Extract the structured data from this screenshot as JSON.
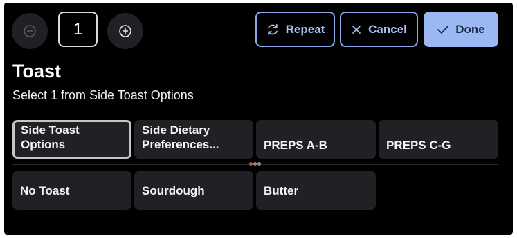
{
  "quantity": {
    "value": "1"
  },
  "actions": {
    "repeat_label": "Repeat",
    "cancel_label": "Cancel",
    "done_label": "Done"
  },
  "header": {
    "title": "Toast",
    "subtitle": "Select 1 from Side Toast Options"
  },
  "groups": [
    {
      "label": "Side Toast Options",
      "selected": true
    },
    {
      "label": "Side Dietary Preferences...",
      "selected": false
    },
    {
      "label": "PREPS A-B",
      "selected": false
    },
    {
      "label": "PREPS C-G",
      "selected": false
    }
  ],
  "pager": {
    "dots": 3,
    "active_index": 0
  },
  "options": [
    {
      "label": "No Toast"
    },
    {
      "label": "Sourdough"
    },
    {
      "label": "Butter"
    }
  ],
  "icons": {
    "decrement": "minus-circle-icon",
    "increment": "plus-circle-icon",
    "repeat": "refresh-icon",
    "cancel": "close-icon",
    "done": "check-icon"
  },
  "colors": {
    "background": "#000000",
    "tile": "#1f2125",
    "accent": "#9bb8f2",
    "pager_active": "#c0532d"
  }
}
